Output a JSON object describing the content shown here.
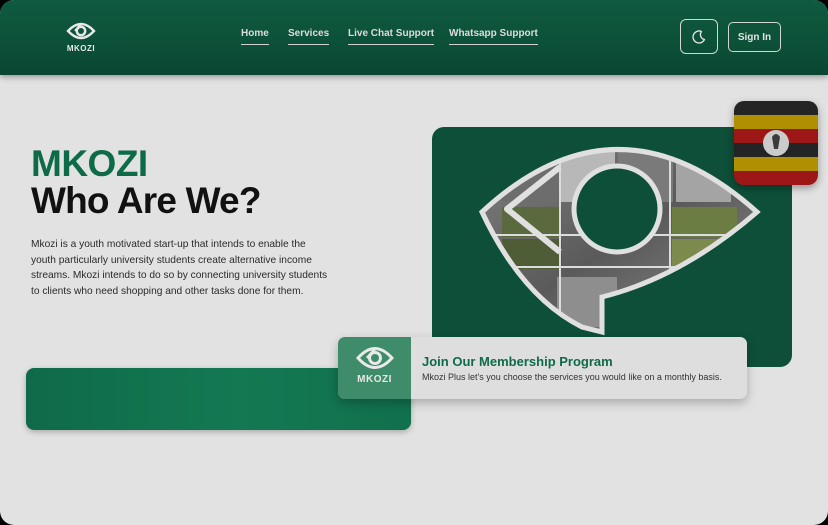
{
  "header": {
    "logo_text": "MKOZI",
    "nav": [
      {
        "label": "Home"
      },
      {
        "label": "Services"
      },
      {
        "label": "Live Chat Support"
      },
      {
        "label": "Whatsapp Support"
      }
    ],
    "dark_mode_icon": "moon-icon",
    "signin_label": "Sign In"
  },
  "hero": {
    "brand": "MKOZI",
    "title": "Who Are We?",
    "description": "Mkozi is a youth motivated start-up that intends to enable the youth particularly university students create alternative income streams. Mkozi intends to do so by connecting university students to clients who need shopping and other tasks done for them."
  },
  "membership": {
    "logo_text": "MKOZI",
    "title": "Join Our Membership Program",
    "description": "Mkozi Plus let's you choose the services you would like on a monthly basis."
  },
  "colors": {
    "brand_green": "#0d6b48",
    "header_green": "#0c5038",
    "card_green": "#0d4f38",
    "background": "#e2e2e2"
  }
}
